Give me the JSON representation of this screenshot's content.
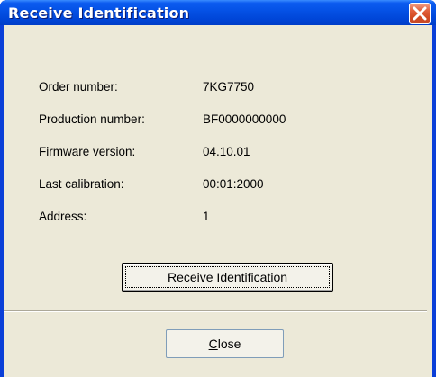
{
  "window": {
    "title": "Receive Identification",
    "close_icon": "close-icon"
  },
  "info": [
    {
      "label": "Order number:",
      "value": "7KG7750"
    },
    {
      "label": "Production number:",
      "value": "BF0000000000"
    },
    {
      "label": "Firmware version:",
      "value": "04.10.01"
    },
    {
      "label": "Last calibration:",
      "value": "00:01:2000"
    },
    {
      "label": "Address:",
      "value": "1"
    }
  ],
  "buttons": {
    "receive": {
      "before": "Receive ",
      "mnemonic": "I",
      "after": "dentification"
    },
    "close": {
      "before": "",
      "mnemonic": "C",
      "after": "lose"
    }
  },
  "colors": {
    "title_bar": "#0552e6",
    "close_button": "#d24a22",
    "dialog_face": "#ece9d8"
  }
}
